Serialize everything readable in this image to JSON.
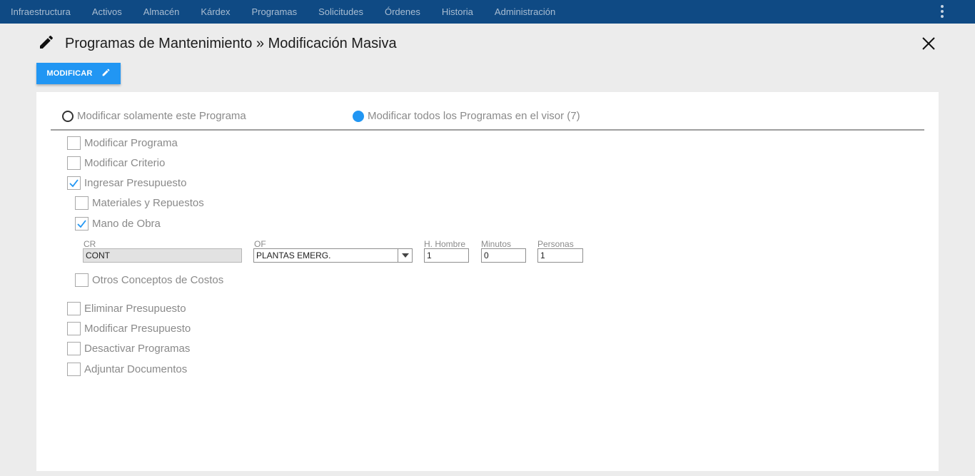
{
  "nav": {
    "items": [
      "Infraestructura",
      "Activos",
      "Almacén",
      "Kárdex",
      "Programas",
      "Solicitudes",
      "Órdenes",
      "Historia",
      "Administración"
    ]
  },
  "header": {
    "title": "Programas de Mantenimiento » Modificación Masiva"
  },
  "toolbar": {
    "modify_label": "MODIFICAR"
  },
  "scope": {
    "option_single": "Modificar solamente este Programa",
    "option_all": "Modificar todos los Programas en el visor (7)",
    "selected": "all"
  },
  "options": {
    "modificar_programa": "Modificar Programa",
    "modificar_criterio": "Modificar Criterio",
    "ingresar_presupuesto": "Ingresar Presupuesto",
    "materiales": "Materiales y Repuestos",
    "mano_obra": "Mano de Obra",
    "otros_conceptos": "Otros Conceptos de Costos",
    "eliminar_presupuesto": "Eliminar Presupuesto",
    "modificar_presupuesto": "Modificar Presupuesto",
    "desactivar_programas": "Desactivar Programas",
    "adjuntar_documentos": "Adjuntar Documentos"
  },
  "labor": {
    "cr_label": "CR",
    "cr_value": "CONT",
    "of_label": "OF",
    "of_value": "PLANTAS EMERG.",
    "hh_label": "H. Hombre",
    "hh_value": "1",
    "min_label": "Minutos",
    "min_value": "0",
    "pers_label": "Personas",
    "pers_value": "1"
  },
  "colors": {
    "nav_bg": "#0f4a84",
    "accent": "#2196f3"
  }
}
